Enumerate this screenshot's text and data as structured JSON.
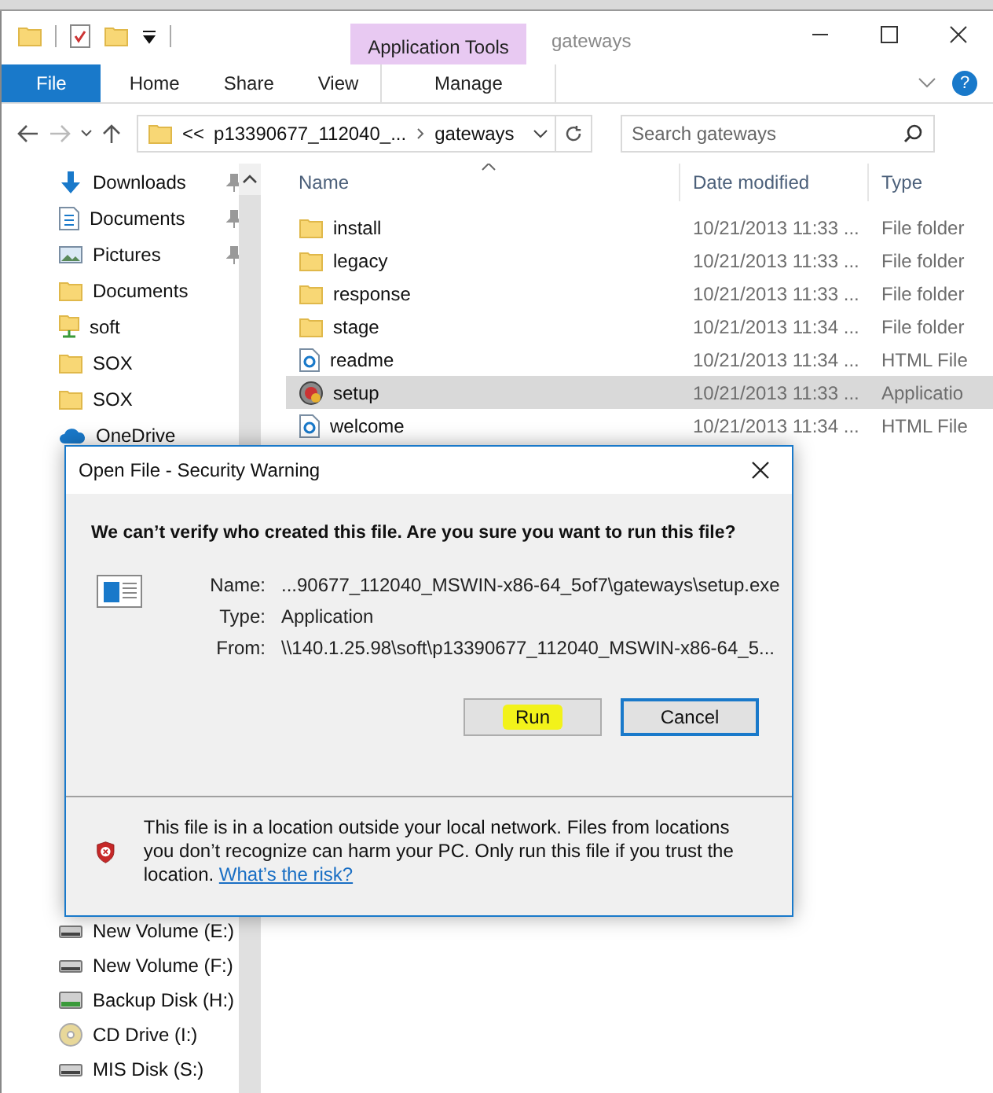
{
  "window": {
    "title": "gateways",
    "contextual_group": "Application Tools"
  },
  "ribbon_tabs": [
    {
      "label": "File",
      "kind": "file"
    },
    {
      "label": "Home",
      "kind": "plain"
    },
    {
      "label": "Share",
      "kind": "plain"
    },
    {
      "label": "View",
      "kind": "plain"
    },
    {
      "label": "Manage",
      "kind": "contextual"
    }
  ],
  "help_label": "?",
  "address": {
    "overflow": "<<",
    "crumbs": [
      "p13390677_112040_...",
      "gateways"
    ]
  },
  "search": {
    "placeholder": "Search gateways"
  },
  "sidebar": {
    "items": [
      {
        "label": "Downloads",
        "kind": "download",
        "pinned": true
      },
      {
        "label": "Documents",
        "kind": "document",
        "pinned": true
      },
      {
        "label": "Pictures",
        "kind": "pictures",
        "pinned": true
      },
      {
        "label": "Documents",
        "kind": "folder",
        "pinned": false
      },
      {
        "label": "soft",
        "kind": "network",
        "pinned": false
      },
      {
        "label": "SOX",
        "kind": "folder",
        "pinned": false
      },
      {
        "label": "SOX",
        "kind": "folder",
        "pinned": false
      },
      {
        "label": "OneDrive",
        "kind": "cloud",
        "pinned": false
      }
    ],
    "lower_items": [
      {
        "label": "New Volume (E:)",
        "kind": "drive"
      },
      {
        "label": "New Volume (F:)",
        "kind": "drive"
      },
      {
        "label": "Backup Disk (H:)",
        "kind": "backup"
      },
      {
        "label": "CD Drive (I:)",
        "kind": "cd"
      },
      {
        "label": "MIS Disk (S:)",
        "kind": "drive"
      }
    ]
  },
  "files": {
    "columns": [
      "Name",
      "Date modified",
      "Type"
    ],
    "rows": [
      {
        "name": "install",
        "date": "10/21/2013 11:33 ...",
        "type": "File folder",
        "kind": "folder",
        "selected": false
      },
      {
        "name": "legacy",
        "date": "10/21/2013 11:33 ...",
        "type": "File folder",
        "kind": "folder",
        "selected": false
      },
      {
        "name": "response",
        "date": "10/21/2013 11:33 ...",
        "type": "File folder",
        "kind": "folder",
        "selected": false
      },
      {
        "name": "stage",
        "date": "10/21/2013 11:34 ...",
        "type": "File folder",
        "kind": "folder",
        "selected": false
      },
      {
        "name": "readme",
        "date": "10/21/2013 11:34 ...",
        "type": "HTML File",
        "kind": "html",
        "selected": false
      },
      {
        "name": "setup",
        "date": "10/21/2013 11:33 ...",
        "type": "Applicatio",
        "kind": "app",
        "selected": true
      },
      {
        "name": "welcome",
        "date": "10/21/2013 11:34 ...",
        "type": "HTML File",
        "kind": "html",
        "selected": false
      }
    ]
  },
  "dialog": {
    "title": "Open File - Security Warning",
    "question": "We can’t verify who created this file. Are you sure you want to run this file?",
    "fields": [
      {
        "label": "Name:",
        "value": "...90677_112040_MSWIN-x86-64_5of7\\gateways\\setup.exe"
      },
      {
        "label": "Type:",
        "value": "Application"
      },
      {
        "label": "From:",
        "value": "\\\\140.1.25.98\\soft\\p13390677_112040_MSWIN-x86-64_5..."
      }
    ],
    "buttons": [
      {
        "label": "Run",
        "highlighted": true,
        "default": false
      },
      {
        "label": "Cancel",
        "highlighted": false,
        "default": true
      }
    ],
    "warning": "This file is in a location outside your local network. Files from locations you don’t recognize can harm your PC. Only run this file if you trust the location.",
    "link": "What’s the risk?"
  }
}
